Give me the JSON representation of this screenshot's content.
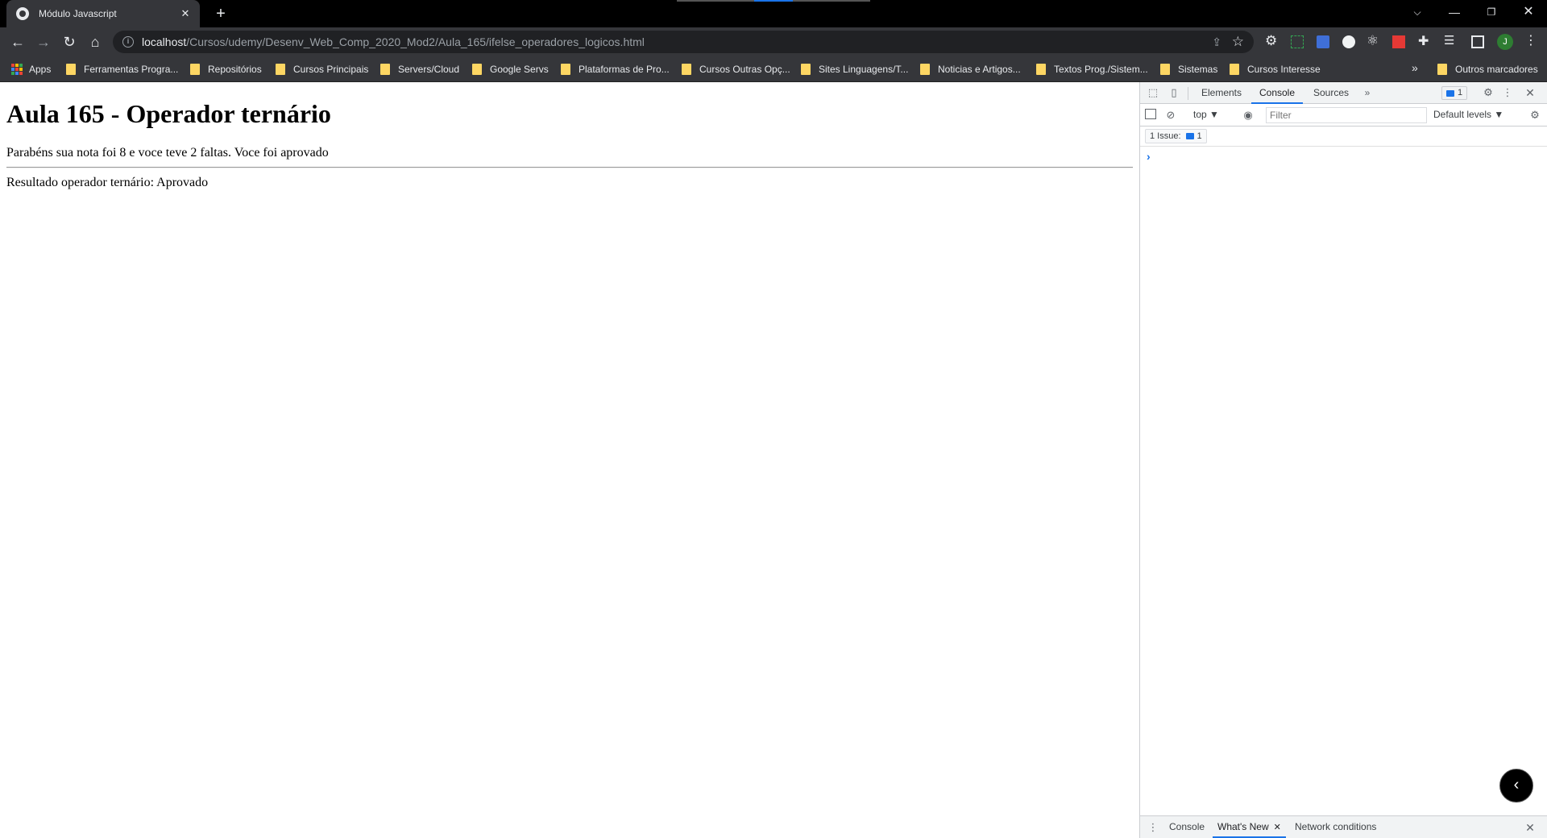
{
  "browser": {
    "tab": {
      "title": "Módulo Javascript",
      "close": "✕"
    },
    "new_tab": "+",
    "window": {
      "tab_search": "⌵",
      "minimize": "—",
      "restore": "❐",
      "close": "✕"
    },
    "nav": {
      "back": "←",
      "forward": "→",
      "reload": "↻",
      "home": "⌂"
    },
    "address": {
      "host": "localhost",
      "path": "/Cursos/udemy/Desenv_Web_Comp_2020_Mod2/Aula_165/ifelse_operadores_logicos.html"
    },
    "profile_initial": "J",
    "bookmarks": {
      "apps": "Apps",
      "items": [
        "Ferramentas Progra...",
        "Repositórios",
        "Cursos Principais",
        "Servers/Cloud",
        "Google Servs",
        "Plataformas de Pro...",
        "Cursos Outras Opç...",
        "Sites Linguagens/T...",
        "Noticias e Artigos...",
        "Textos Prog./Sistem...",
        "Sistemas",
        "Cursos Interesse"
      ],
      "more": "»",
      "other": "Outros marcadores"
    }
  },
  "page": {
    "heading": "Aula 165 - Operador ternário",
    "line1": "Parabéns sua nota foi 8 e voce teve 2 faltas. Voce foi aprovado",
    "line2": "Resultado operador ternário: Aprovado"
  },
  "devtools": {
    "tabs": {
      "elements": "Elements",
      "console": "Console",
      "sources": "Sources",
      "more": "»"
    },
    "issues_badge_count": "1",
    "console_toolbar": {
      "context": "top ▼",
      "filter_placeholder": "Filter",
      "levels": "Default levels ▼"
    },
    "issues_label": "1 Issue:",
    "issues_count": "1",
    "prompt": "›",
    "drawer": {
      "console": "Console",
      "whats_new": "What's New",
      "network_conditions": "Network conditions"
    }
  },
  "colors": {
    "accent": "#1a73e8",
    "chrome_dark": "#35363a",
    "folder": "#fdd663"
  }
}
